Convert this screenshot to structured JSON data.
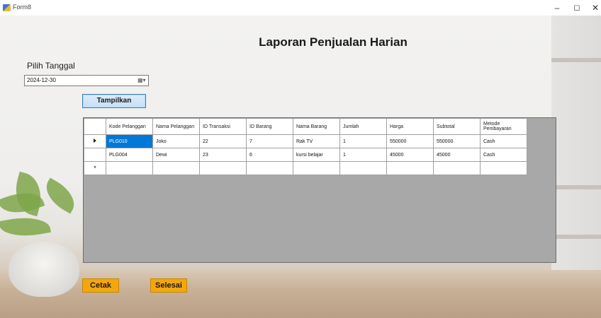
{
  "window": {
    "title": "Form8"
  },
  "controls": {
    "minimize": "–",
    "maximize": "◻",
    "close": "✕"
  },
  "form": {
    "heading": "Laporan Penjualan Harian",
    "date_label": "Pilih Tanggal",
    "date_value": "2024-12-30",
    "show_button": "Tampilkan",
    "print_button": "Cetak",
    "finish_button": "Selesai"
  },
  "grid": {
    "columns": [
      "Kode Pelanggan",
      "Nama Pelanggan",
      "ID Transaksi",
      "ID Barang",
      "Nama Barang",
      "Jumlah",
      "Harga",
      "Subtotal",
      "Metode Pembayaran"
    ],
    "rows": [
      [
        "PLG010",
        "Joko",
        "22",
        "7",
        "Rak TV",
        "1",
        "550000",
        "550000",
        "Cash"
      ],
      [
        "PLG004",
        "Dewi",
        "23",
        "6",
        "kursi belajar",
        "1",
        "45000",
        "45000",
        "Cash"
      ]
    ],
    "selected_color": "#0078d7"
  },
  "icons": {
    "calendar": "calendar-dropdown-icon",
    "current_row": "row-arrow-icon",
    "new_row": "new-row-star-icon"
  }
}
